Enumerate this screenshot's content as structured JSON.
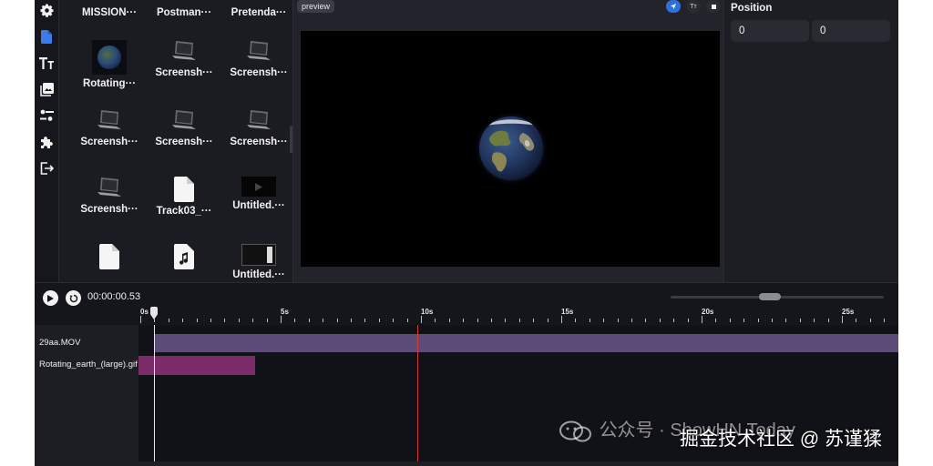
{
  "icons": {
    "rail": [
      "gear-icon",
      "file-icon",
      "text-icon",
      "gallery-icon",
      "sliders-icon",
      "puzzle-icon",
      "export-icon"
    ]
  },
  "library": {
    "items": [
      {
        "label": "MISSION···",
        "kind": "file"
      },
      {
        "label": "Postman···",
        "kind": "laptop"
      },
      {
        "label": "Pretenda···",
        "kind": "laptop"
      },
      {
        "label": "Rotating···",
        "kind": "globe"
      },
      {
        "label": "Screensh···",
        "kind": "laptop"
      },
      {
        "label": "Screensh···",
        "kind": "laptop"
      },
      {
        "label": "Screensh···",
        "kind": "laptop"
      },
      {
        "label": "Screensh···",
        "kind": "laptop"
      },
      {
        "label": "Screensh···",
        "kind": "laptop"
      },
      {
        "label": "Screensh···",
        "kind": "laptop"
      },
      {
        "label": "Track03_···",
        "kind": "file"
      },
      {
        "label": "Untitled.···",
        "kind": "video"
      },
      {
        "label": "",
        "kind": "file"
      },
      {
        "label": "",
        "kind": "audio"
      },
      {
        "label": "Untitled.···",
        "kind": "video-frame"
      }
    ]
  },
  "preview": {
    "tag": "preview",
    "text_tool": "Tт"
  },
  "properties": {
    "title": "Position",
    "x_value": "0",
    "y_value": "0"
  },
  "timeline": {
    "timecode": "00:00:00.53",
    "ruler_labels": [
      "0s",
      "5s",
      "10s",
      "15s",
      "20s",
      "25s"
    ],
    "tracks": [
      {
        "name": "29aa.MOV",
        "clip_color": "#5b4d78"
      },
      {
        "name": "Rotating_earth_(large).gif",
        "clip_color": "#7d2c6a"
      }
    ],
    "playhead_color": "#e8e8e8",
    "marker_color": "#d23a3a"
  },
  "watermark": {
    "line_top": "公众号 · ShowHN Today",
    "line_bottom": "掘金技术社区 @ 苏谨猱"
  },
  "colors": {
    "accent": "#2f6fde",
    "panel": "#1b1c22"
  }
}
